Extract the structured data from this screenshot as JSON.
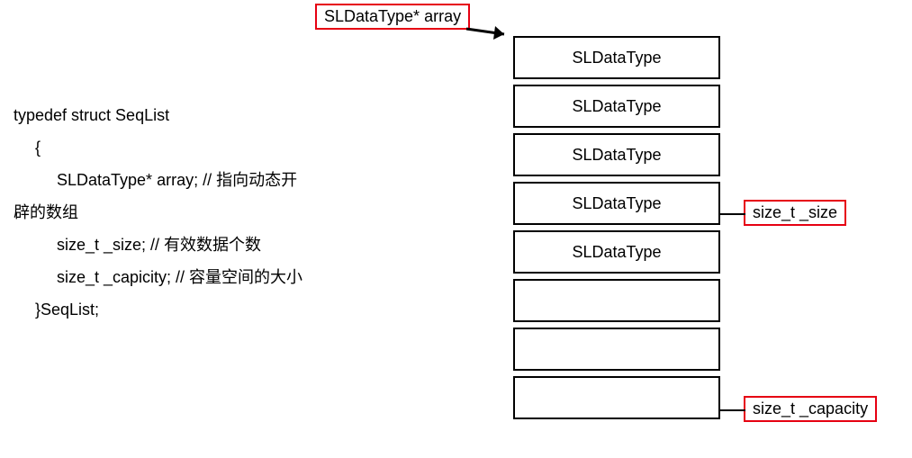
{
  "code": {
    "l1": "typedef struct SeqList",
    "l2": "{",
    "l3": "SLDataType* array; // 指向动态开",
    "l4": "辟的数组",
    "l5": "size_t _size; // 有效数据个数",
    "l6": "size_t _capicity; // 容量空间的大小",
    "l7": "}SeqList;"
  },
  "labels": {
    "array": "SLDataType* array",
    "size": "size_t _size",
    "capacity": "size_t _capacity"
  },
  "cells": {
    "c0": "SLDataType",
    "c1": "SLDataType",
    "c2": "SLDataType",
    "c3": "SLDataType",
    "c4": "SLDataType",
    "c5": "",
    "c6": "",
    "c7": ""
  }
}
